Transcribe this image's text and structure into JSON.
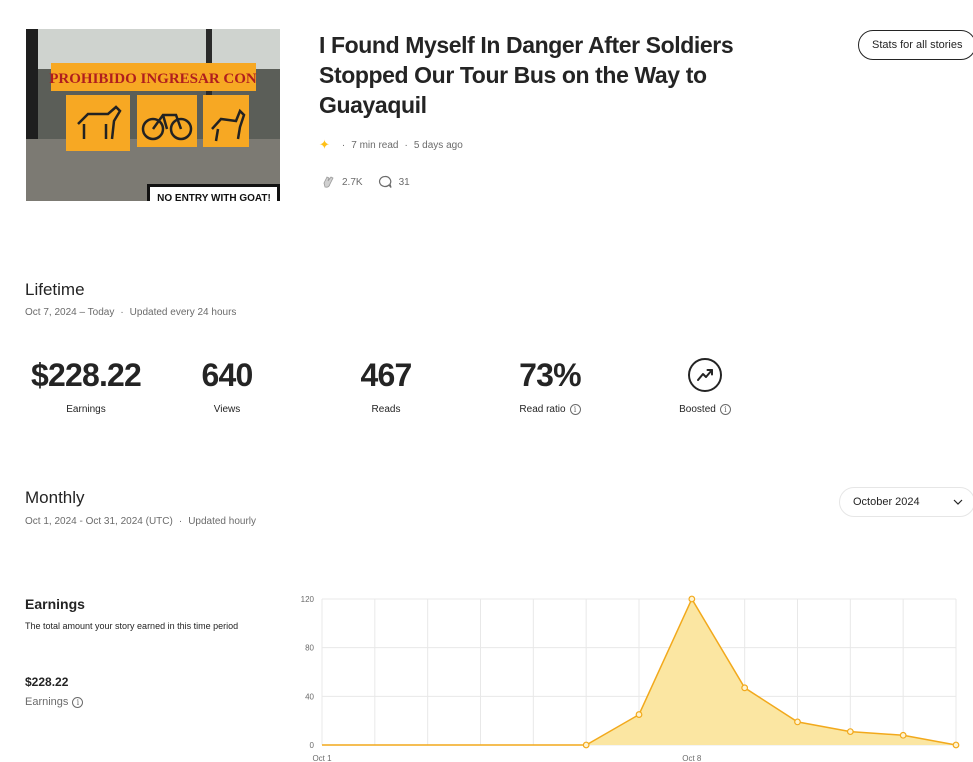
{
  "story": {
    "title": "I Found Myself In Danger After Soldiers Stopped Our Tour Bus on the Way to Guayaquil",
    "read_time": "7 min read",
    "published": "5 days ago",
    "claps": "2.7K",
    "responses": "31",
    "thumbnail": {
      "sign_text": "PROHIBIDO INGRESAR CON",
      "footer_text": "NO ENTRY WITH GOAT!"
    }
  },
  "header": {
    "stats_button": "Stats for all stories"
  },
  "lifetime": {
    "title": "Lifetime",
    "range": "Oct 7, 2024 – Today",
    "update": "Updated every 24 hours",
    "stats": [
      {
        "value": "$228.22",
        "label": "Earnings"
      },
      {
        "value": "640",
        "label": "Views"
      },
      {
        "value": "467",
        "label": "Reads"
      },
      {
        "value": "73%",
        "label": "Read ratio"
      },
      {
        "label": "Boosted"
      }
    ]
  },
  "monthly": {
    "title": "Monthly",
    "range": "Oct 1, 2024 - Oct 31, 2024 (UTC)",
    "update": "Updated hourly",
    "month_select": "October 2024"
  },
  "earnings": {
    "title": "Earnings",
    "description": "The total amount your story earned in this time period",
    "amount": "$228.22",
    "label": "Earnings"
  },
  "colors": {
    "accent_star": "#ffc017",
    "line": "#f2a91c",
    "fill": "#fbe6a2",
    "text": "#242424",
    "muted": "#6b6b6b"
  },
  "chart_data": {
    "type": "area",
    "x": [
      "Oct 1",
      "Oct 2",
      "Oct 3",
      "Oct 4",
      "Oct 5",
      "Oct 6",
      "Oct 7",
      "Oct 8",
      "Oct 9",
      "Oct 10",
      "Oct 11",
      "Oct 12",
      "Oct 13"
    ],
    "x_tick_labels": [
      "Oct 1",
      "Oct 8"
    ],
    "values": [
      0,
      0,
      0,
      0,
      0,
      0,
      25,
      120,
      47,
      19,
      11,
      8,
      0
    ],
    "yticks": [
      0,
      40,
      80,
      120
    ],
    "ylim": [
      0,
      120
    ],
    "grid": true
  }
}
